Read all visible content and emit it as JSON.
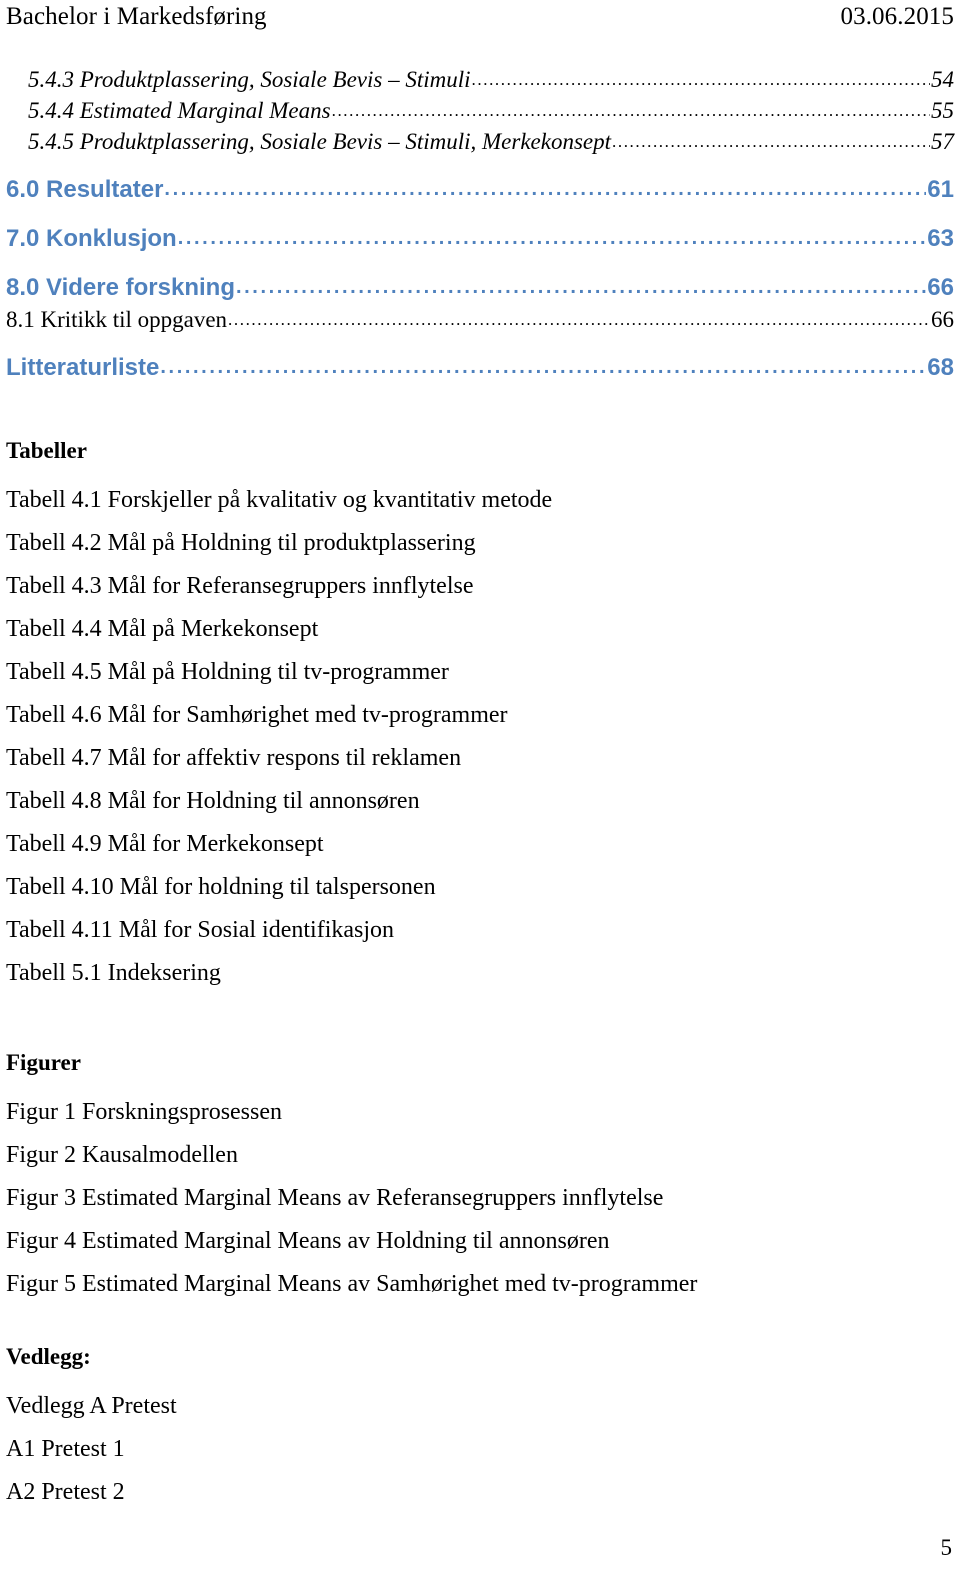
{
  "header": {
    "title": "Bachelor i Markedsføring",
    "date": "03.06.2015"
  },
  "toc": {
    "entries": [
      {
        "level": 3,
        "text": "5.4.3 Produktplassering, Sosiale Bevis – Stimuli",
        "page": "54"
      },
      {
        "level": 3,
        "text": "5.4.4 Estimated Marginal Means",
        "page": "55"
      },
      {
        "level": 3,
        "text": "5.4.5 Produktplassering, Sosiale Bevis – Stimuli, Merkekonsept",
        "page": "57"
      },
      {
        "level": 1,
        "text": "6.0 Resultater",
        "page": "61"
      },
      {
        "level": 1,
        "text": "7.0 Konklusjon",
        "page": "63"
      },
      {
        "level": 1,
        "text": "8.0 Videre forskning",
        "page": "66"
      },
      {
        "level": 2,
        "text": "8.1 Kritikk til oppgaven",
        "page": "66"
      },
      {
        "level": 1,
        "text": "Litteraturliste",
        "page": "68"
      }
    ]
  },
  "tabeller": {
    "title": "Tabeller",
    "items": [
      "Tabell 4.1 Forskjeller på kvalitativ og kvantitativ metode",
      "Tabell 4.2 Mål på Holdning til produktplassering",
      "Tabell 4.3 Mål for Referansegruppers innflytelse",
      "Tabell 4.4 Mål på Merkekonsept",
      "Tabell 4.5 Mål på Holdning til tv-programmer",
      "Tabell 4.6 Mål for Samhørighet med tv-programmer",
      "Tabell 4.7 Mål for affektiv respons til reklamen",
      "Tabell 4.8 Mål for Holdning til annonsøren",
      "Tabell 4.9 Mål for Merkekonsept",
      "Tabell 4.10 Mål for holdning til talspersonen",
      "Tabell 4.11 Mål for Sosial identifikasjon",
      "Tabell 5.1 Indeksering"
    ]
  },
  "figurer": {
    "title": "Figurer",
    "items": [
      "Figur 1 Forskningsprosessen",
      "Figur 2 Kausalmodellen",
      "Figur 3 Estimated Marginal Means av Referansegruppers innflytelse",
      "Figur 4 Estimated Marginal Means av Holdning til annonsøren",
      "Figur 5 Estimated Marginal Means av Samhørighet med tv-programmer"
    ]
  },
  "vedlegg": {
    "title": "Vedlegg:",
    "items": [
      "Vedlegg A Pretest",
      "A1 Pretest 1",
      "A2 Pretest 2"
    ]
  },
  "footer": {
    "page_number": "5"
  },
  "colors": {
    "heading_blue": "#4F81BD",
    "body_black": "#000000",
    "background": "#ffffff"
  },
  "leader_dots": "...................................................................................................................................................................................................."
}
